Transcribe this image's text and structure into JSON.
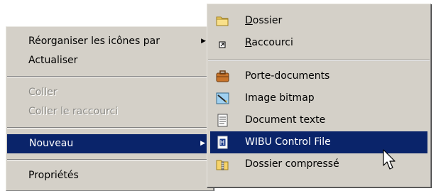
{
  "context_menu": {
    "items": [
      {
        "label": "Réorganiser les icônes par",
        "has_submenu": true,
        "enabled": true
      },
      {
        "label": "Actualiser",
        "enabled": true
      },
      {
        "label": "Coller",
        "enabled": false
      },
      {
        "label": "Coller le raccourci",
        "enabled": false
      },
      {
        "label": "Nouveau",
        "has_submenu": true,
        "enabled": true,
        "selected": true
      },
      {
        "label": "Propriétés",
        "enabled": true
      }
    ],
    "submenu_arrow": "▶"
  },
  "new_submenu": {
    "items": [
      {
        "accel": "D",
        "rest": "ossier",
        "icon": "folder-icon"
      },
      {
        "accel": "R",
        "rest": "accourci",
        "icon": "shortcut-icon"
      },
      {
        "label": "Porte-documents",
        "icon": "briefcase-icon"
      },
      {
        "label": "Image bitmap",
        "icon": "bitmap-icon"
      },
      {
        "label": "Document texte",
        "icon": "text-document-icon"
      },
      {
        "label": "WIBU Control File",
        "icon": "wibu-file-icon",
        "selected": true
      },
      {
        "label": "Dossier compressé",
        "icon": "zip-folder-icon"
      }
    ]
  },
  "colors": {
    "menu_bg": "#d4d0c8",
    "highlight": "#0a246a",
    "disabled_text": "#8c8b86"
  }
}
